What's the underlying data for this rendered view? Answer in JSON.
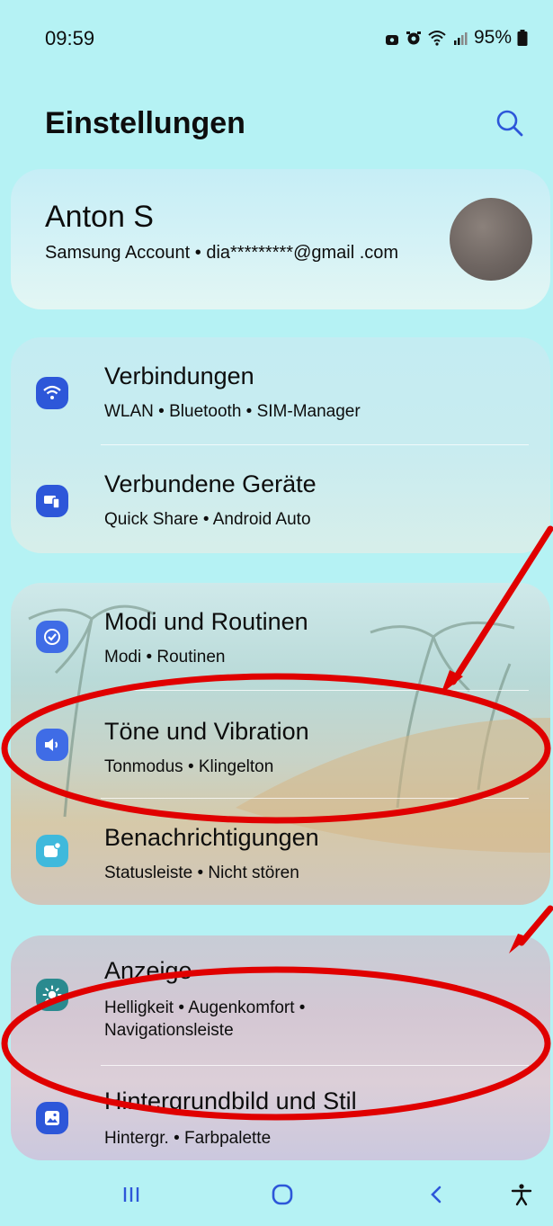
{
  "status_bar": {
    "time": "09:59",
    "battery": "95%",
    "icons": [
      "lock-icon",
      "alarm-icon",
      "wifi-icon",
      "signal-icon",
      "battery-icon"
    ]
  },
  "header": {
    "title": "Einstellungen",
    "search_icon": "search-icon"
  },
  "account": {
    "name": "Anton S",
    "subtitle": "Samsung Account  •  dia*********@gmail .com"
  },
  "groups": [
    {
      "items": [
        {
          "title": "Verbindungen",
          "subtitle": "WLAN  •  Bluetooth  •  SIM-Manager",
          "icon": "wifi-icon",
          "color": "#2d57d9"
        },
        {
          "title": "Verbundene Geräte",
          "subtitle": "Quick Share  •  Android Auto",
          "icon": "devices-icon",
          "color": "#2d57d9"
        }
      ]
    },
    {
      "items": [
        {
          "title": "Modi und Routinen",
          "subtitle": "Modi  •  Routinen",
          "icon": "routines-icon",
          "color": "#3f6ce6"
        },
        {
          "title": "Töne und Vibration",
          "subtitle": "Tonmodus  •  Klingelton",
          "icon": "sound-icon",
          "color": "#3f6ce6"
        },
        {
          "title": "Benachrichtigungen",
          "subtitle": "Statusleiste  •  Nicht stören",
          "icon": "notifications-icon",
          "color": "#3fb9dc"
        }
      ]
    },
    {
      "items": [
        {
          "title": "Anzeige",
          "subtitle": "Helligkeit  •  Augenkomfort  •  Navigationsleiste",
          "icon": "brightness-icon",
          "color": "#2a8a8f"
        },
        {
          "title": "Hintergrundbild und Stil",
          "subtitle": "Hintergr.  •  Farbpalette",
          "icon": "wallpaper-icon",
          "color": "#2d57d9"
        }
      ]
    }
  ],
  "nav_bar": {
    "icons": [
      "recents-icon",
      "home-icon",
      "back-icon",
      "accessibility-icon"
    ]
  },
  "colors": {
    "background": "#b5f2f4",
    "annotation_red": "#e00000",
    "accent": "#2d57d9"
  }
}
